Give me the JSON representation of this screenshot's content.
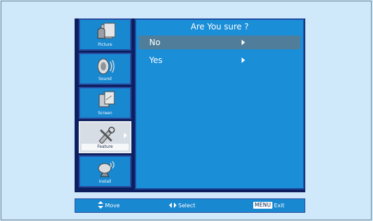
{
  "sidebar": {
    "items": [
      {
        "label": "Picture",
        "icon": "picture-icon"
      },
      {
        "label": "Sound",
        "icon": "sound-icon"
      },
      {
        "label": "Screen",
        "icon": "screen-icon"
      },
      {
        "label": "Feature",
        "icon": "feature-icon",
        "active": true
      },
      {
        "label": "Install",
        "icon": "install-icon"
      }
    ]
  },
  "dialog": {
    "title": "Are You sure ?",
    "options": [
      {
        "label": "No",
        "selected": true
      },
      {
        "label": "Yes",
        "selected": false
      }
    ]
  },
  "footer": {
    "move": "Move",
    "select": "Select",
    "menu_key": "MENU",
    "exit": "Exit"
  },
  "colors": {
    "background": "#cfe9fb",
    "panel": "#1b8ed8",
    "selected_row": "#4f7d9a",
    "active_tab": "#d6dde4"
  }
}
